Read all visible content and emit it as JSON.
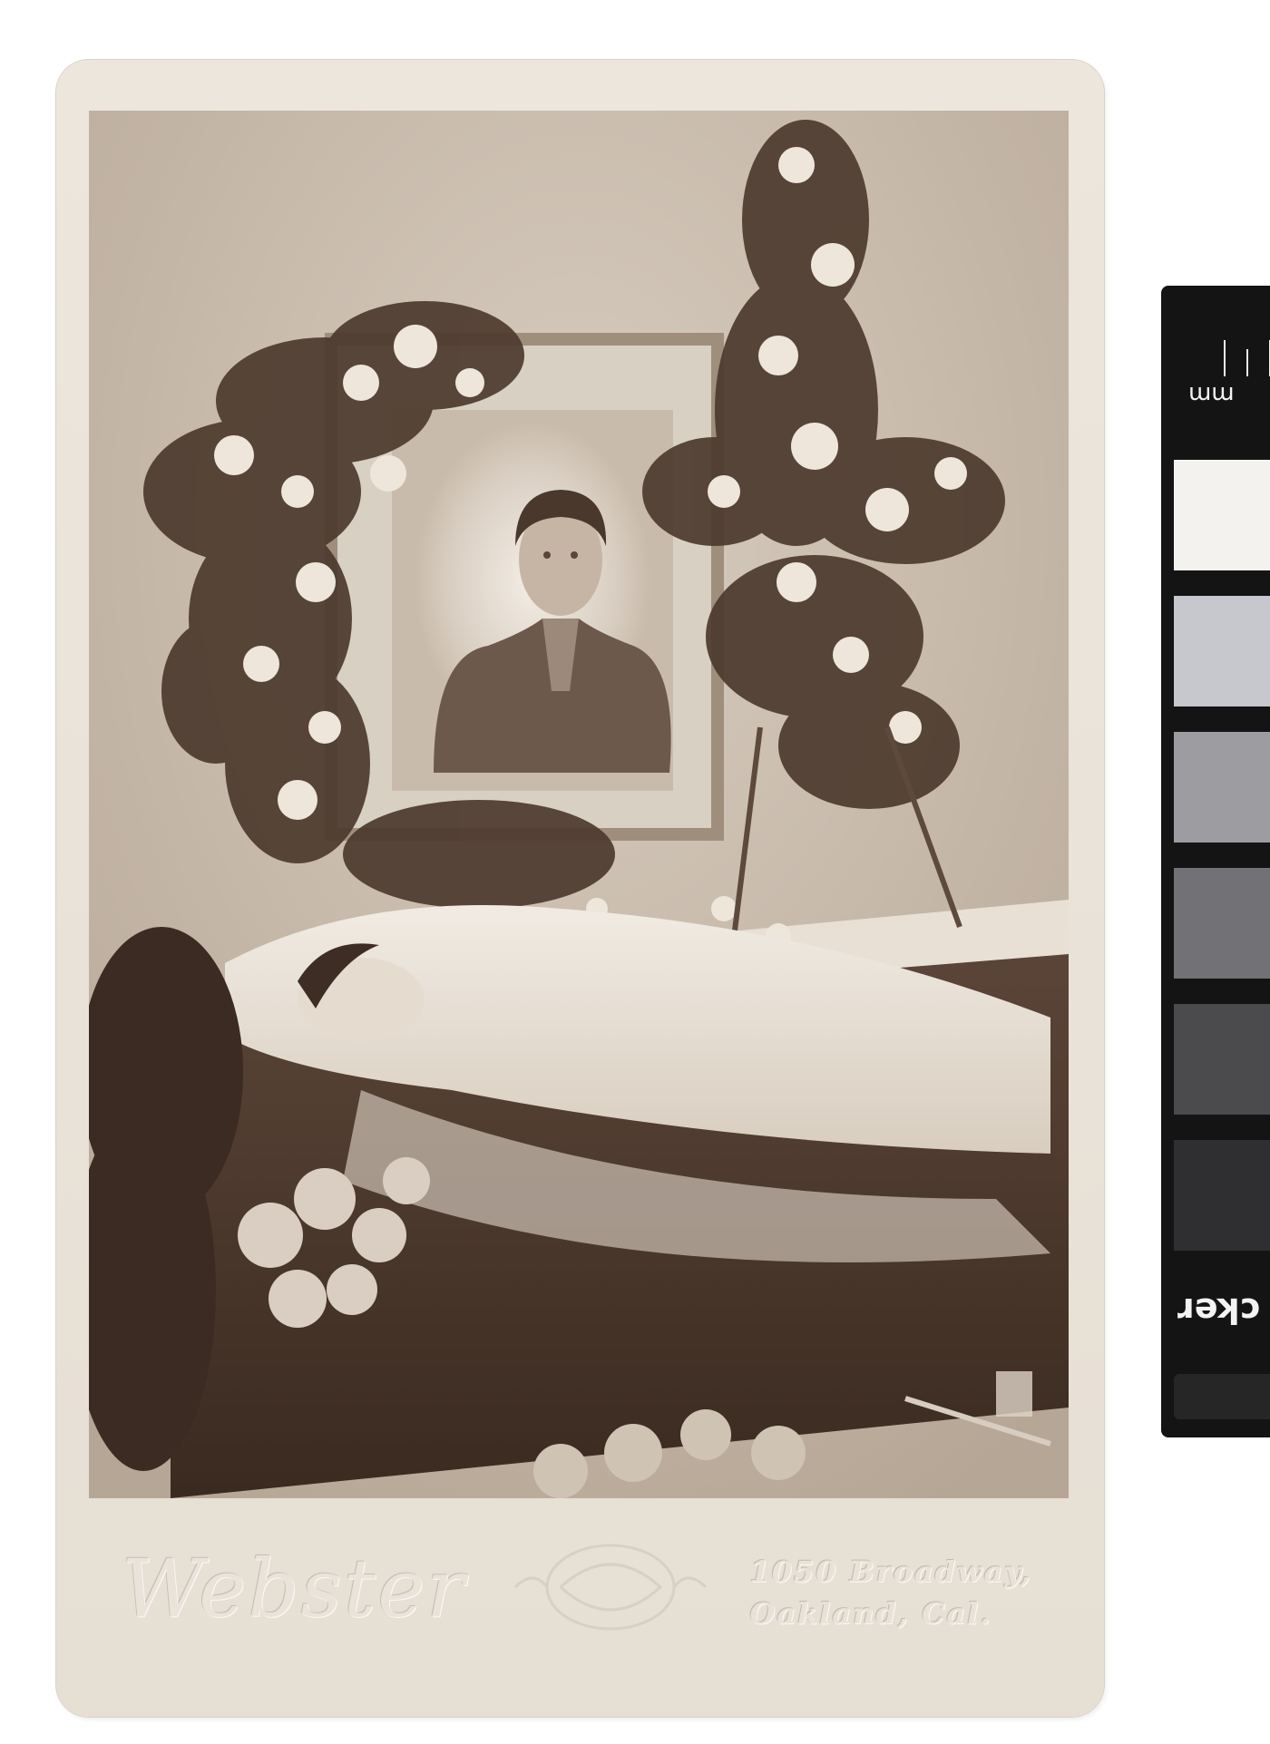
{
  "image": {
    "subject": "cabinet-card-photograph",
    "tone": "sepia",
    "card_color": "#ebe5dc",
    "photo_tone": "#b7a898"
  },
  "imprint": {
    "photographer": "Webster",
    "address_line_1": "1050 Broadway,",
    "address_line_2": "Oakland, Cal."
  },
  "color_target": {
    "scale_unit": "mm",
    "brand_fragment": "cker",
    "patches": [
      "#f4f2ee",
      "#c7c8cd",
      "#9c9ca1",
      "#727276",
      "#4b4b4e",
      "#2f2f31"
    ]
  }
}
